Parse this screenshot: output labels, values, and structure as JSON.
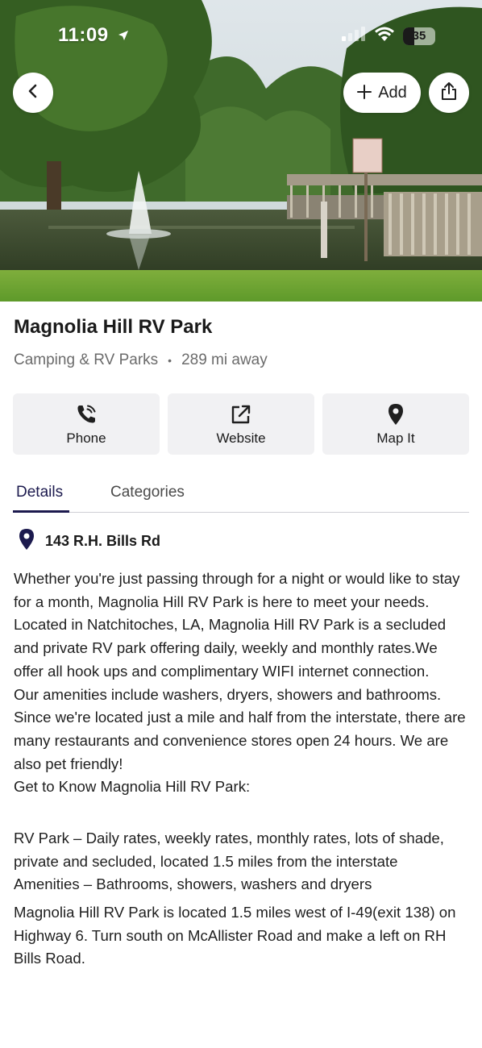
{
  "status": {
    "time": "11:09",
    "battery": "35"
  },
  "header": {
    "add_label": "Add"
  },
  "place": {
    "name": "Magnolia Hill RV Park",
    "category": "Camping & RV Parks",
    "distance": "289 mi away",
    "address": "143 R.H. Bills Rd"
  },
  "actions": [
    {
      "label": "Phone",
      "icon": "phone-icon"
    },
    {
      "label": "Website",
      "icon": "external-link-icon"
    },
    {
      "label": "Map It",
      "icon": "map-pin-icon"
    }
  ],
  "tabs": [
    {
      "label": "Details",
      "active": true
    },
    {
      "label": "Categories",
      "active": false
    }
  ],
  "description": {
    "p1": "Whether you're just passing through for a night or would like to stay for a month, Magnolia Hill RV Park is here to meet your needs. Located in Natchitoches, LA, Magnolia Hill RV Park is a secluded and private RV park offering daily, weekly and monthly rates.We offer all hook ups and complimentary WIFI internet connection.",
    "p2": "Our amenities include washers, dryers, showers and bathrooms. Since we're located just a mile and half from the interstate, there are many restaurants and convenience stores open 24 hours. We are also pet friendly!",
    "p3": "Get to Know Magnolia Hill RV Park:",
    "p4": "RV Park – Daily rates, weekly rates, monthly rates, lots of shade, private and secluded, located 1.5 miles from the interstate",
    "p5": "Amenities – Bathrooms, showers, washers and dryers",
    "p6": "Magnolia Hill RV Park is located 1.5 miles west of I-49(exit 138) on Highway 6. Turn south on McAllister Road and make a left on RH Bills Road."
  },
  "colors": {
    "accent": "#1c1a4e",
    "button_bg": "#f1f1f3",
    "muted_text": "#6b6b6b"
  }
}
